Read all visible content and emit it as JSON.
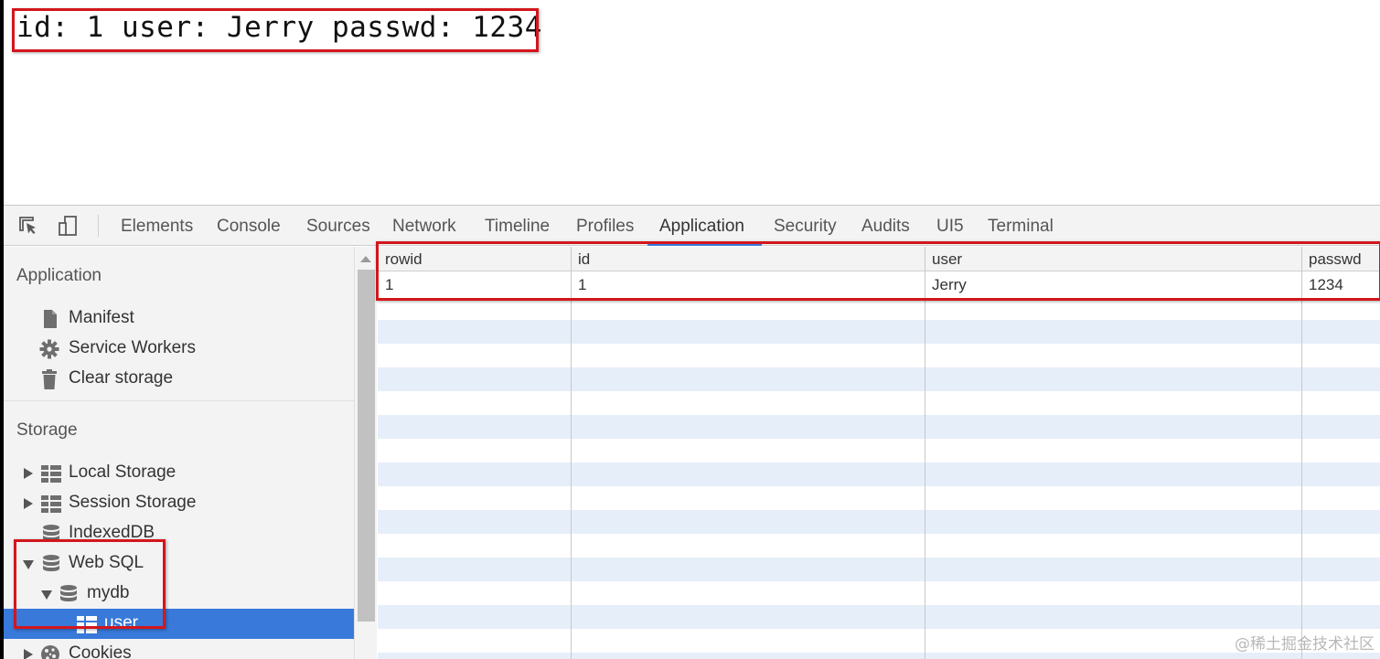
{
  "page_output": {
    "text": "id: 1 user: Jerry passwd: 1234"
  },
  "devtools": {
    "tabs": [
      {
        "label": "Elements"
      },
      {
        "label": "Console"
      },
      {
        "label": "Sources"
      },
      {
        "label": "Network"
      },
      {
        "label": "Timeline"
      },
      {
        "label": "Profiles"
      },
      {
        "label": "Application",
        "active": true
      },
      {
        "label": "Security"
      },
      {
        "label": "Audits"
      },
      {
        "label": "UI5"
      },
      {
        "label": "Terminal"
      }
    ],
    "toolbar_icons": [
      "inspect-element-icon",
      "device-toolbar-icon"
    ],
    "accent_color": "#3879d9"
  },
  "sidebar": {
    "application_title": "Application",
    "application_items": [
      {
        "label": "Manifest",
        "icon": "document-icon"
      },
      {
        "label": "Service Workers",
        "icon": "gear-icon"
      },
      {
        "label": "Clear storage",
        "icon": "trash-icon"
      }
    ],
    "storage_title": "Storage",
    "storage_items": [
      {
        "label": "Local Storage",
        "icon": "table-icon",
        "expander": "collapsed"
      },
      {
        "label": "Session Storage",
        "icon": "table-icon",
        "expander": "collapsed"
      },
      {
        "label": "IndexedDB",
        "icon": "database-icon",
        "expander": "none"
      },
      {
        "label": "Web SQL",
        "icon": "database-icon",
        "expander": "expanded"
      },
      {
        "label": "mydb",
        "icon": "database-icon",
        "expander": "expanded"
      },
      {
        "label": "user",
        "icon": "table-icon",
        "expander": "none",
        "selected": true
      },
      {
        "label": "Cookies",
        "icon": "cookie-icon",
        "expander": "collapsed"
      }
    ]
  },
  "table": {
    "columns": [
      "rowid",
      "id",
      "user",
      "passwd"
    ],
    "rows": [
      [
        "1",
        "1",
        "Jerry",
        "1234"
      ]
    ]
  },
  "watermark": "@稀土掘金技术社区",
  "highlight_color": "#d3161c"
}
